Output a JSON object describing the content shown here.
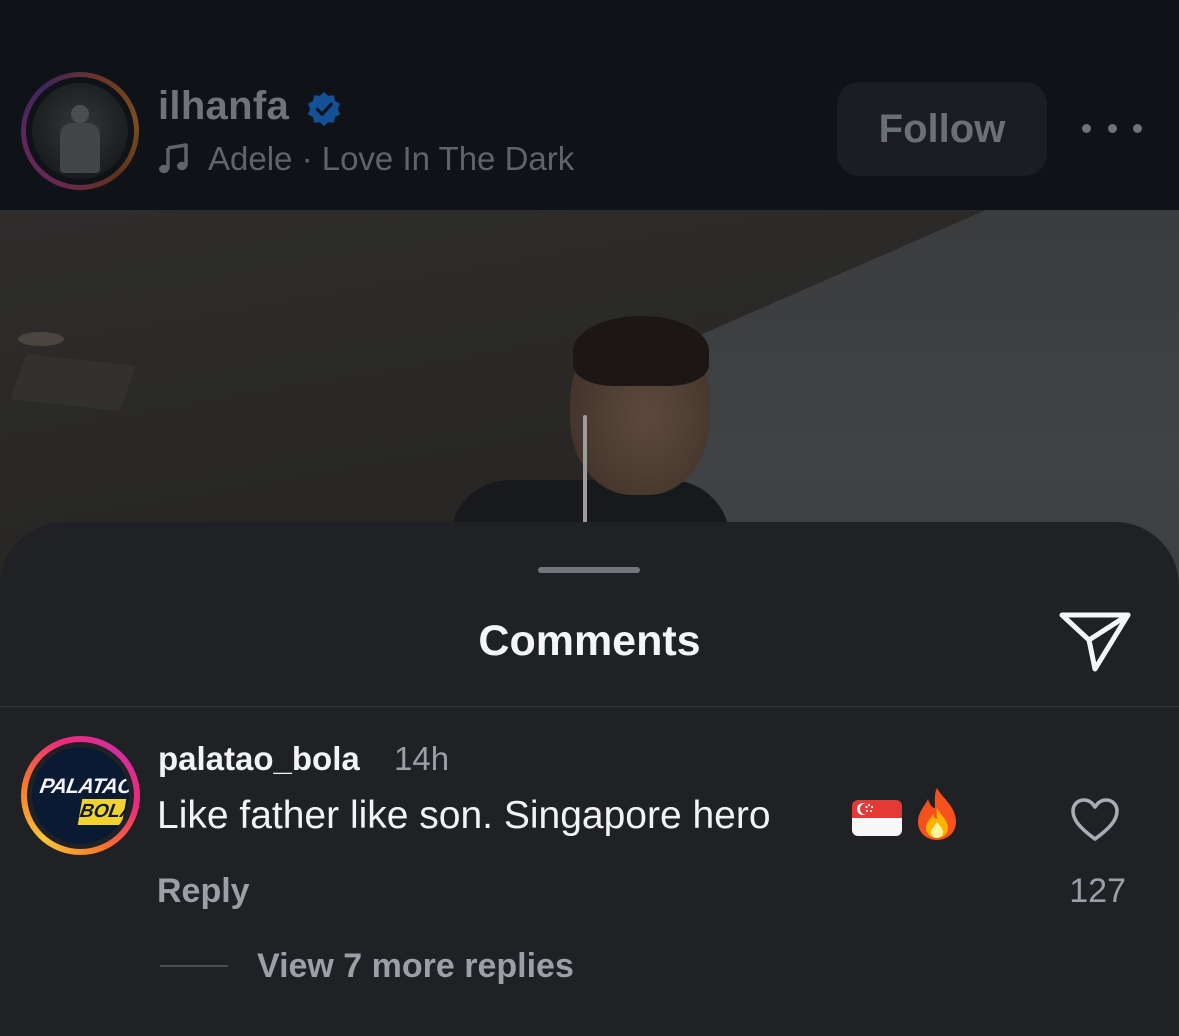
{
  "header": {
    "username": "ilhanfa",
    "verified": true,
    "music_artist_song": "Adele · Love In The Dark",
    "follow_label": "Follow",
    "icons": {
      "avatar": "profile-avatar",
      "verified": "verified-badge-icon",
      "music": "music-note-icon",
      "more": "more-dots-icon"
    }
  },
  "sheet": {
    "title": "Comments",
    "share_icon": "send-paper-plane-icon"
  },
  "comment": {
    "username": "palatao_bola",
    "time": "14h",
    "text": "Like father like son. Singapore hero",
    "emojis": [
      "singapore-flag",
      "fire"
    ],
    "avatar_logo_line1": "PALATAO",
    "avatar_logo_line2": "BOLA",
    "reply_label": "Reply",
    "like_count": "127",
    "view_replies_label": "View 7 more replies"
  },
  "colors": {
    "sheet_bg": "#202125",
    "header_bg": "#0f1216",
    "verified_blue": "#1877f2",
    "text_primary": "#f2f3f5",
    "text_secondary": "#9c9fa6"
  }
}
